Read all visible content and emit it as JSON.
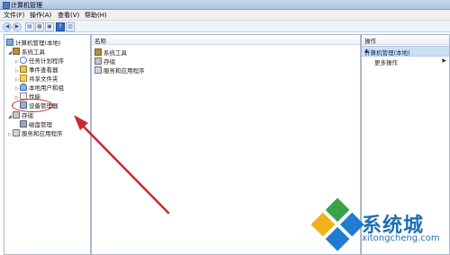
{
  "window": {
    "title": "计算机管理"
  },
  "menu": [
    "文件(F)",
    "操作(A)",
    "查看(V)",
    "帮助(H)"
  ],
  "tree": {
    "root": "计算机管理(本地)",
    "system_tools": "系统工具",
    "task_scheduler": "任务计划程序",
    "event_viewer": "事件查看器",
    "shared_folders": "共享文件夹",
    "local_users": "本地用户和组",
    "performance": "性能",
    "device_manager": "设备管理器",
    "storage": "存储",
    "disk_management": "磁盘管理",
    "services_apps": "服务和应用程序"
  },
  "content": {
    "column_name": "名称",
    "items": [
      "系统工具",
      "存储",
      "服务和应用程序"
    ]
  },
  "actions": {
    "header": "操作",
    "group": "计算机管理(本地)",
    "more": "更多操作"
  },
  "watermark": {
    "brand": "系统城",
    "url": "xitongcheng.com"
  }
}
